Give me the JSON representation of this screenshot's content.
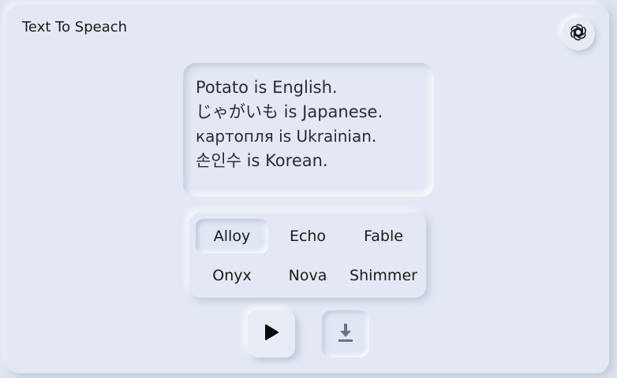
{
  "app": {
    "title": "Text To Speach",
    "logo_icon": "openai-logo-icon"
  },
  "input": {
    "lines": [
      "Potato is English.",
      "じゃがいも is Japanese.",
      "картопля is Ukrainian.",
      "손인수 is Korean."
    ]
  },
  "voices": {
    "options": [
      "Alloy",
      "Echo",
      "Fable",
      "Onyx",
      "Nova",
      "Shimmer"
    ],
    "selected": "Alloy"
  },
  "controls": {
    "play_icon": "play-icon",
    "download_icon": "download-icon"
  },
  "colors": {
    "background": "#dde3f0",
    "surface": "#e3e8f4",
    "text": "#1a1a1a",
    "icon_muted": "#6f7380"
  }
}
